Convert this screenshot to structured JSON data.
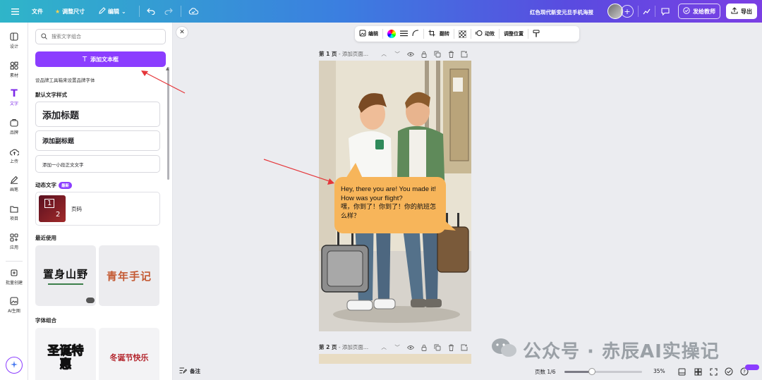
{
  "topbar": {
    "file": "文件",
    "resize": "调整尺寸",
    "edit": "编辑",
    "doc_title": "红色现代新变元旦手机海报",
    "share": "发给教师",
    "export": "导出"
  },
  "rail": [
    {
      "label": "设计",
      "icon": "layout-icon"
    },
    {
      "label": "素材",
      "icon": "elements-icon"
    },
    {
      "label": "文字",
      "icon": "text-icon",
      "active": true
    },
    {
      "label": "品牌",
      "icon": "brand-icon"
    },
    {
      "label": "上传",
      "icon": "upload-icon"
    },
    {
      "label": "画笔",
      "icon": "draw-icon"
    },
    {
      "label": "项目",
      "icon": "folder-icon"
    },
    {
      "label": "应用",
      "icon": "apps-icon"
    },
    {
      "label": "批量创建",
      "icon": "bulk-icon"
    },
    {
      "label": "AI生图",
      "icon": "ai-image-icon"
    }
  ],
  "panel": {
    "search_placeholder": "搜索文字组合",
    "add_textbox": "添加文本框",
    "brand_note": "设品牌工具箱来设置品牌字体",
    "default_styles_title": "默认文字样式",
    "heading": "添加标题",
    "subheading": "添加副标题",
    "body": "添加一小段正文文字",
    "dynamic_title": "动态文字",
    "new_badge": "最新",
    "dynamic_item": "页码",
    "recent_title": "最近使用",
    "recent_1": "置身山野",
    "recent_2": "青年手记",
    "combos_title": "字体组合",
    "combo_1": "圣诞特惠",
    "combo_2": "冬诞节快乐"
  },
  "ctx_toolbar": {
    "edit": "编辑",
    "flip": "翻转",
    "animate": "动效",
    "position": "调整位置"
  },
  "pages": {
    "page1_label": "第 1 页",
    "page1_title": "- 添加页面...",
    "page2_label": "第 2 页",
    "page2_title": "- 添加页面..."
  },
  "bubble": {
    "line_en": "Hey, there you are! You made it! How was your flight?",
    "line_zh": "嘿，你到了！你到了！你的航班怎么样？"
  },
  "bottom": {
    "notes": "备注",
    "pages": "页数 1/6",
    "zoom": "35%",
    "zoom_fraction": 0.35
  },
  "watermark": "公众号 · 赤辰AI实操记",
  "colors": {
    "accent": "#8b3dff",
    "bubble": "#f7b55a"
  }
}
